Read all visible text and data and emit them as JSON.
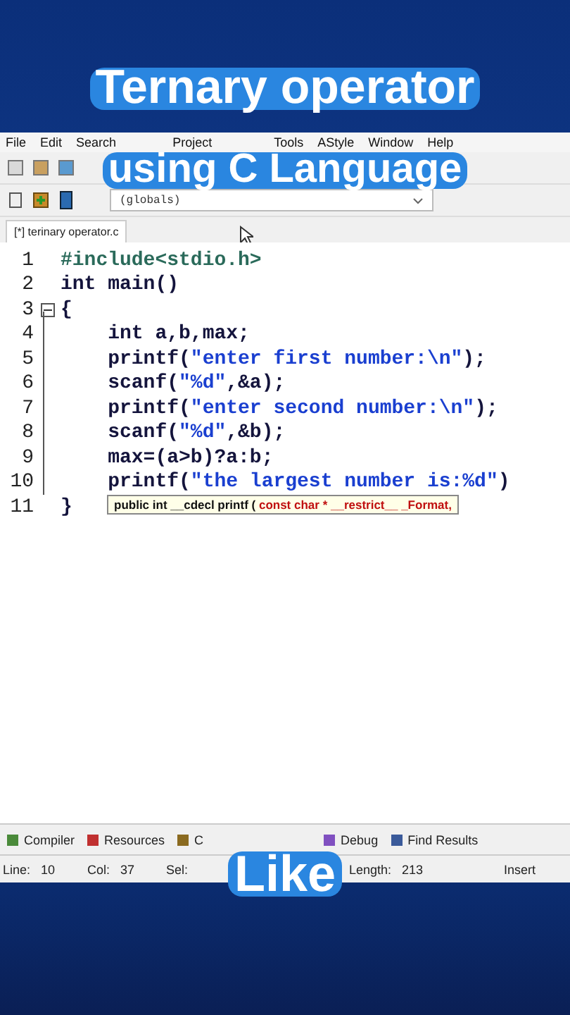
{
  "overlay_captions": [
    "Ternary operator",
    "using C Language"
  ],
  "menu": [
    "File",
    "Edit",
    "Search",
    "Project",
    "Tools",
    "AStyle",
    "Window",
    "Help"
  ],
  "scope_field": {
    "value": "(globals)"
  },
  "file_tab": {
    "label": "[*] terinary operator.c",
    "selected": true
  },
  "code_lines": [
    {
      "number": "1",
      "segments": [
        {
          "text": "#include<stdio.h>",
          "kind": "preprocessor"
        }
      ]
    },
    {
      "number": "2",
      "segments": [
        {
          "text": "int main()",
          "kind": "code"
        }
      ]
    },
    {
      "number": "3",
      "fold": true,
      "segments": [
        {
          "text": "{",
          "kind": "code"
        }
      ]
    },
    {
      "number": "4",
      "segments": [
        {
          "text": "    int a,b,max;",
          "kind": "code"
        }
      ]
    },
    {
      "number": "5",
      "segments": [
        {
          "text": "    printf(",
          "kind": "code"
        },
        {
          "text": "\"enter first number:\\n\"",
          "kind": "string"
        },
        {
          "text": ");",
          "kind": "code"
        }
      ]
    },
    {
      "number": "6",
      "segments": [
        {
          "text": "    scanf(",
          "kind": "code"
        },
        {
          "text": "\"%d\"",
          "kind": "string"
        },
        {
          "text": ",&a);",
          "kind": "code"
        }
      ]
    },
    {
      "number": "7",
      "segments": [
        {
          "text": "    printf(",
          "kind": "code"
        },
        {
          "text": "\"enter second number:\\n\"",
          "kind": "string"
        },
        {
          "text": ");",
          "kind": "code"
        }
      ]
    },
    {
      "number": "8",
      "segments": [
        {
          "text": "    scanf(",
          "kind": "code"
        },
        {
          "text": "\"%d\"",
          "kind": "string"
        },
        {
          "text": ",&b);",
          "kind": "code"
        }
      ]
    },
    {
      "number": "9",
      "segments": [
        {
          "text": "    max=(a>b)?a:b;",
          "kind": "code"
        }
      ]
    },
    {
      "number": "10",
      "segments": [
        {
          "text": "    printf(",
          "kind": "code"
        },
        {
          "text": "\"the largest number is:%d\"",
          "kind": "string"
        },
        {
          "text": ")",
          "kind": "code"
        }
      ]
    },
    {
      "number": "11",
      "segments": [
        {
          "text": "}",
          "kind": "code"
        }
      ]
    }
  ],
  "tooltip": {
    "signature": "public int __cdecl printf (",
    "params": "const char * __restrict__ _Format,"
  },
  "bottom_tabs": [
    {
      "label": "Compiler"
    },
    {
      "label": "Resources"
    },
    {
      "label": "C"
    },
    {
      "label": "Debug"
    },
    {
      "label": "Find Results"
    }
  ],
  "status_bar": [
    {
      "label": "Line:",
      "value": "10"
    },
    {
      "label": "Col:",
      "value": "37"
    },
    {
      "label": "Sel:"
    },
    {
      "label": "Length:",
      "value": "213"
    },
    {
      "label": "Insert"
    }
  ],
  "like_caption": "Like"
}
